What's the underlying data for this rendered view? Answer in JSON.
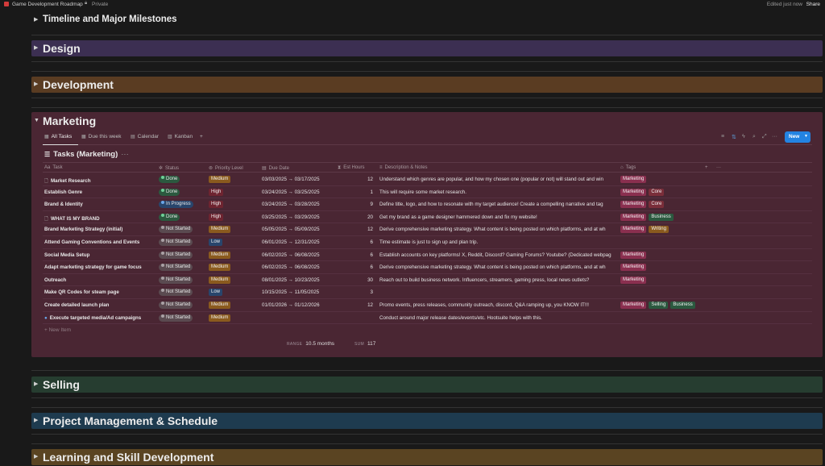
{
  "topbar": {
    "title": "Game Development Roadmap",
    "privacy": "Private",
    "edited": "Edited just now",
    "share": "Share"
  },
  "sections": {
    "timeline": "Timeline and Major Milestones",
    "design": "Design",
    "development": "Development",
    "marketing": "Marketing",
    "selling": "Selling",
    "pm": "Project Management & Schedule",
    "learning": "Learning and Skill Development"
  },
  "colors": {
    "page_bg": "#191919",
    "design": "#3c2f52",
    "development": "#5a3c22",
    "marketing": "#4a2633",
    "selling": "#263d30",
    "pm": "#1e3b4f",
    "learning": "#5a4422",
    "accent": "#2383e2"
  },
  "views": [
    "All Tasks",
    "Due this week",
    "Calendar",
    "Kanban"
  ],
  "new_button": "New",
  "db_title": "Tasks (Marketing)",
  "columns": [
    "Task",
    "Status",
    "Priority Level",
    "Due Date",
    "Est Hours",
    "Description & Notes",
    "Tags"
  ],
  "rows": [
    {
      "task": "Market Research",
      "page_icon": true,
      "status": "Done",
      "priority": "Medium",
      "date": "03/03/2025 → 03/17/2025",
      "hours": "12",
      "desc": "Understand which genres are popular, and how my chosen one (popular or not) will stand out and win",
      "tags": [
        "Marketing"
      ]
    },
    {
      "task": "Establish Genre",
      "status": "Done",
      "priority": "High",
      "date": "03/24/2025 → 03/25/2025",
      "hours": "1",
      "desc": "This will require some market research.",
      "tags": [
        "Marketing",
        "Core"
      ]
    },
    {
      "task": "Brand & Identity",
      "status": "In Progress",
      "priority": "High",
      "date": "03/24/2025 → 03/28/2025",
      "hours": "9",
      "desc": "Define title, logo, and how to resonate with my target audience! Create a compelling narrative and tag",
      "tags": [
        "Marketing",
        "Core"
      ]
    },
    {
      "task": "WHAT IS MY BRAND",
      "page_icon": true,
      "status": "Done",
      "priority": "High",
      "date": "03/25/2025 → 03/29/2025",
      "hours": "20",
      "desc": "Get my brand as a game designer hammered down and fix my website!",
      "tags": [
        "Marketing",
        "Business"
      ]
    },
    {
      "task": "Brand Marketing Strategy (initial)",
      "status": "Not Started",
      "priority": "Medium",
      "date": "05/05/2025 → 05/09/2025",
      "hours": "12",
      "desc": "Derive comprehensive marketing strategy. What content is being posted on which platforms, and at wh",
      "tags": [
        "Marketing",
        "Writing"
      ]
    },
    {
      "task": "Attend Gaming Conventions and Events",
      "status": "Not Started",
      "priority": "Low",
      "date": "06/01/2025 → 12/31/2025",
      "hours": "6",
      "desc": "Time estimate is just to sign up and plan trip.",
      "tags": []
    },
    {
      "task": "Social Media Setup",
      "status": "Not Started",
      "priority": "Medium",
      "date": "06/02/2025 → 06/08/2025",
      "hours": "6",
      "desc": "Establish accounts on key platforms! X, Reddit, Discord? Gaming Forums? Youtube? (Dedicated webpag",
      "tags": [
        "Marketing"
      ]
    },
    {
      "task": "Adapt marketing strategy for game focus",
      "status": "Not Started",
      "priority": "Medium",
      "date": "06/02/2025 → 06/08/2025",
      "hours": "6",
      "desc": "Derive comprehensive marketing strategy. What content is being posted on which platforms, and at wh",
      "tags": [
        "Marketing"
      ]
    },
    {
      "task": "Outreach",
      "status": "Not Started",
      "priority": "Medium",
      "date": "08/01/2025 → 10/23/2025",
      "hours": "30",
      "desc": "Reach out to build business network. Influencers, streamers, gaming press, local news outlets?",
      "tags": [
        "Marketing"
      ]
    },
    {
      "task": "Make QR Codes for steam page",
      "status": "Not Started",
      "priority": "Low",
      "date": "10/15/2025 → 11/05/2025",
      "hours": "3",
      "desc": "",
      "tags": []
    },
    {
      "task": "Create detailed launch plan",
      "status": "Not Started",
      "priority": "Medium",
      "date": "01/01/2026 → 01/12/2026",
      "hours": "12",
      "desc": "Promo events, press releases, community outreach, discord, Q&A ramping up, you KNOW IT!!!",
      "tags": [
        "Marketing",
        "Selling",
        "Business"
      ]
    },
    {
      "task": "Execute targeted media/Ad campaigns",
      "chat_icon": true,
      "status": "Not Started",
      "priority": "Medium",
      "date": "",
      "hours": "",
      "desc": "Conduct around major release dates/events/etc. Hootsuite helps with this.",
      "tags": []
    }
  ],
  "new_item": "New Item",
  "calc": {
    "range_label": "RANGE",
    "range_value": "10.5 months",
    "sum_label": "SUM",
    "sum_value": "117"
  }
}
